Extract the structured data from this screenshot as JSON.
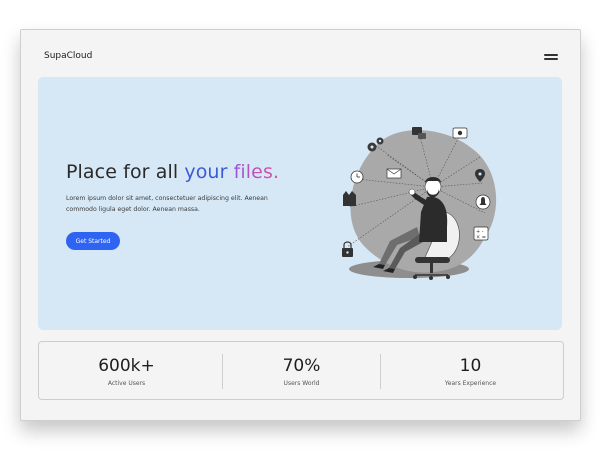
{
  "header": {
    "brand": "SupaCloud"
  },
  "hero": {
    "headline_part1": "Place for all ",
    "headline_part2": "your",
    "headline_part3": "files.",
    "description": "Lorem ipsum dolor sit amet, consectetuer adipiscing elit. Aenean commodo ligula eget dolor. Aenean massa.",
    "cta_label": "Get Started"
  },
  "stats": [
    {
      "value": "600k+",
      "label": "Active Users"
    },
    {
      "value": "70%",
      "label": "Users World"
    },
    {
      "value": "10",
      "label": "Years Experience"
    }
  ],
  "colors": {
    "accent": "#2f63f2",
    "hero_bg": "#d6e8f6",
    "headline_blue": "#3d5ad6"
  }
}
